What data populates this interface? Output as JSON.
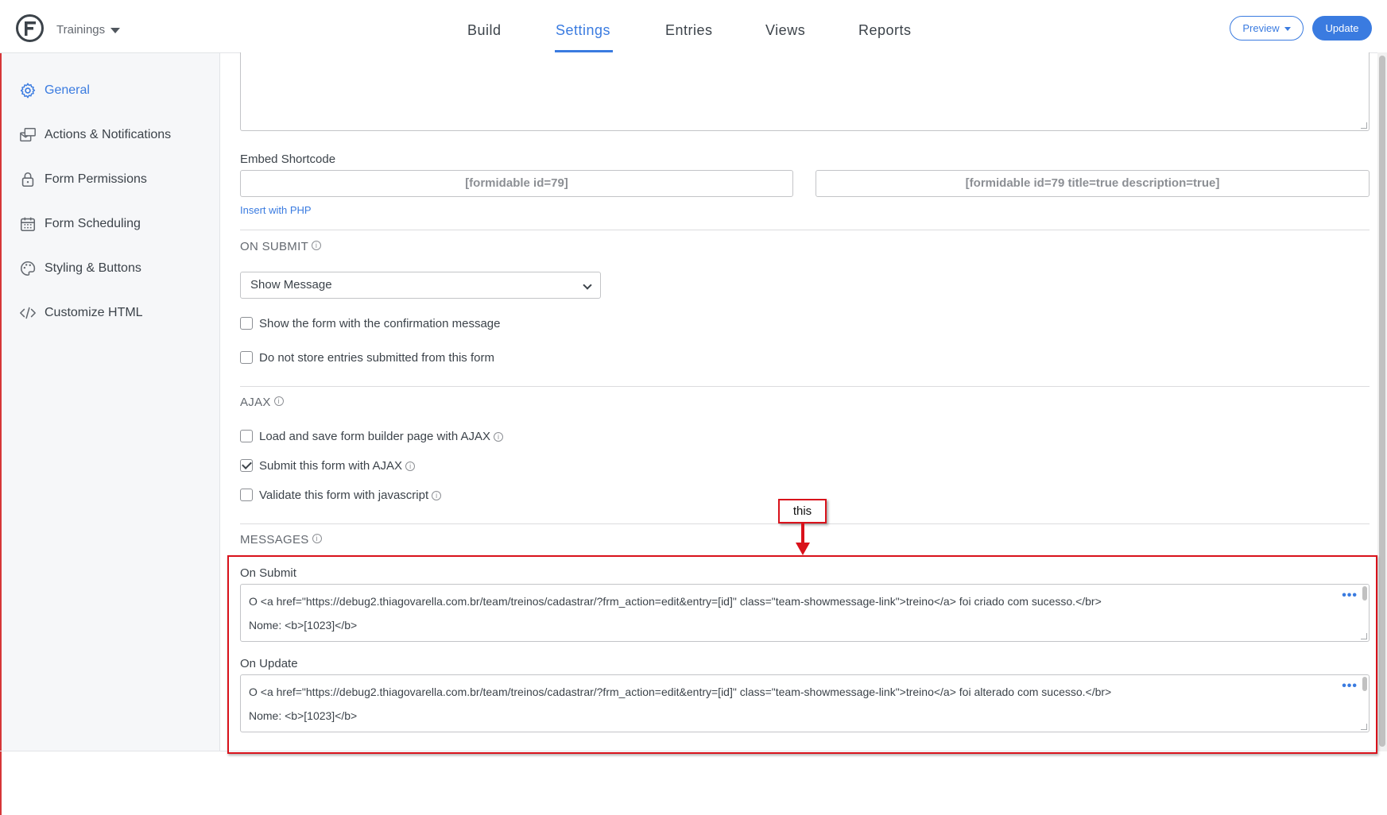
{
  "header": {
    "form_name": "Trainings",
    "tabs": [
      {
        "label": "Build"
      },
      {
        "label": "Settings"
      },
      {
        "label": "Entries"
      },
      {
        "label": "Views"
      },
      {
        "label": "Reports"
      }
    ],
    "active_tab": "Settings",
    "preview_label": "Preview",
    "update_label": "Update",
    "accent_color": "#3a7be0"
  },
  "sidebar": {
    "items": [
      {
        "label": "General",
        "icon": "gear-icon",
        "active": true
      },
      {
        "label": "Actions & Notifications",
        "icon": "notifications-icon",
        "active": false
      },
      {
        "label": "Form Permissions",
        "icon": "lock-icon",
        "active": false
      },
      {
        "label": "Form Scheduling",
        "icon": "calendar-icon",
        "active": false
      },
      {
        "label": "Styling & Buttons",
        "icon": "palette-icon",
        "active": false
      },
      {
        "label": "Customize HTML",
        "icon": "code-icon",
        "active": false
      }
    ]
  },
  "embed": {
    "label": "Embed Shortcode",
    "shortcode_simple": "[formidable id=79]",
    "shortcode_full": "[formidable id=79 title=true description=true]",
    "php_link": "Insert with PHP"
  },
  "on_submit": {
    "title": "ON SUBMIT",
    "selected_action": "Show Message",
    "options": [
      {
        "label": "Show the form with the confirmation message",
        "checked": false
      },
      {
        "label": "Do not store entries submitted from this form",
        "checked": false
      }
    ]
  },
  "ajax": {
    "title": "AJAX",
    "options": [
      {
        "label": "Load and save form builder page with AJAX",
        "checked": false
      },
      {
        "label": "Submit this form with AJAX",
        "checked": true
      },
      {
        "label": "Validate this form with javascript",
        "checked": false
      }
    ]
  },
  "messages": {
    "title": "MESSAGES",
    "on_submit_label": "On Submit",
    "on_submit_lines": [
      "O <a href=\"https://debug2.thiagovarella.com.br/team/treinos/cadastrar/?frm_action=edit&entry=[id]\" class=\"team-showmessage-link\">treino</a> foi criado com sucesso.</br>",
      "Nome: <b>[1023]</b>"
    ],
    "on_update_label": "On Update",
    "on_update_lines": [
      "O <a href=\"https://debug2.thiagovarella.com.br/team/treinos/cadastrar/?frm_action=edit&entry=[id]\" class=\"team-showmessage-link\">treino</a> foi alterado com sucesso.</br>",
      "Nome: <b>[1023]</b>"
    ],
    "more_label": "•••"
  },
  "annotation": {
    "note": "this",
    "color": "#d9121b"
  }
}
